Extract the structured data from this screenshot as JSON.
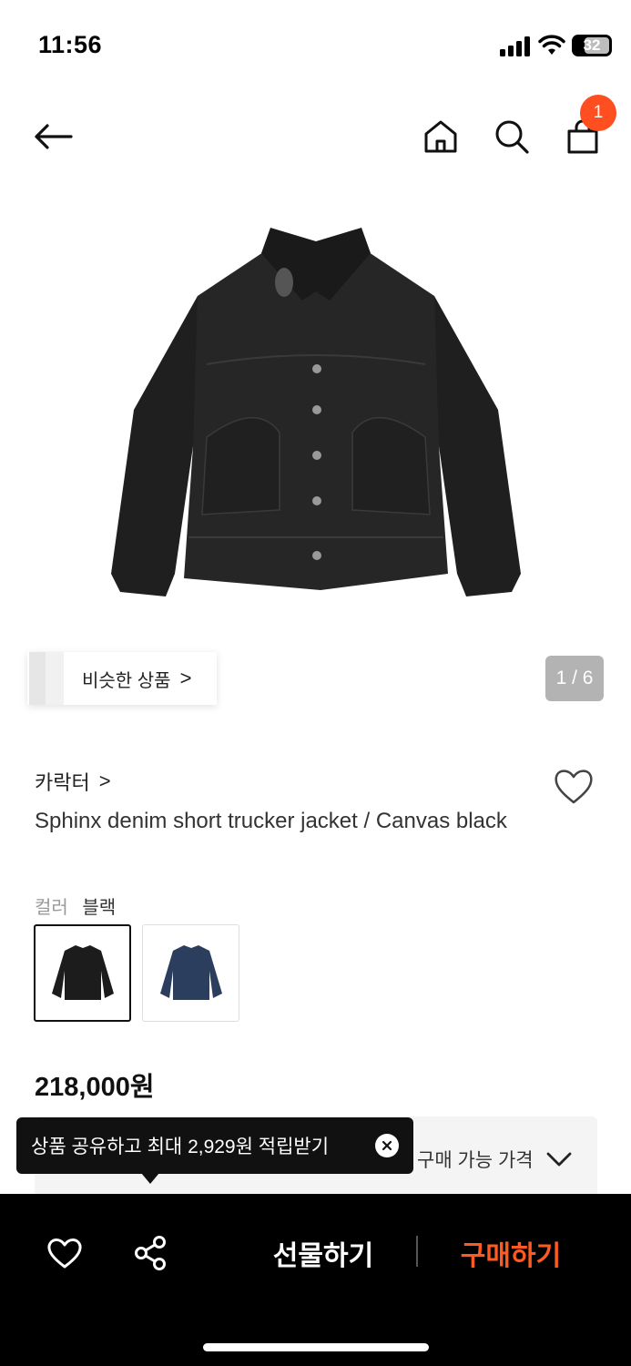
{
  "status_bar": {
    "time": "11:56",
    "battery": "32"
  },
  "nav": {
    "cart_count": "1"
  },
  "gallery": {
    "similar_label": "비슷한 상품",
    "similar_arrow": ">",
    "page_counter": "1 / 6"
  },
  "product": {
    "brand": "카락터",
    "brand_arrow": ">",
    "name": "Sphinx denim short trucker jacket / Canvas black",
    "color_key": "컬러",
    "color_value": "블랙",
    "price": "218,000원",
    "available_price_label": "구매 가능 가격"
  },
  "tooltip": {
    "text": "상품 공유하고 최대 2,929원 적립받기"
  },
  "bottom_bar": {
    "gift_label": "선물하기",
    "buy_label": "구매하기"
  },
  "colors": {
    "accent": "#ff4e1f",
    "buy": "#ff5a1f",
    "bar": "#000000"
  }
}
